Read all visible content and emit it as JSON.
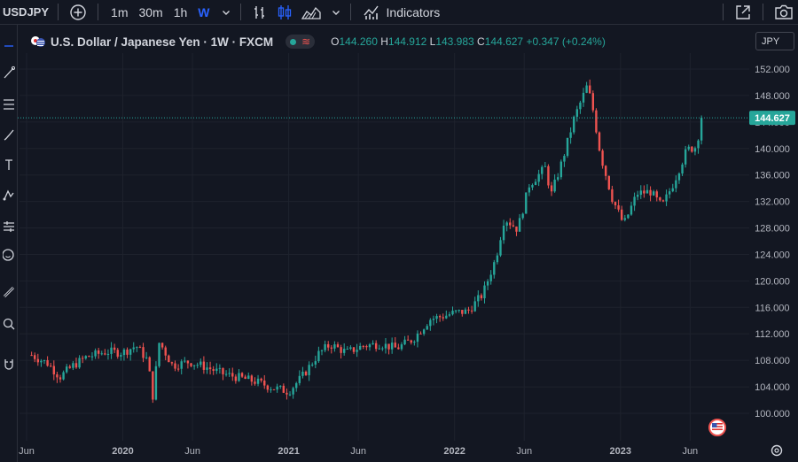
{
  "toolbar": {
    "symbol": "USDJPY",
    "intervals": [
      "1m",
      "30m",
      "1h",
      "W"
    ],
    "indicators_label": "Indicators"
  },
  "legend": {
    "title": "U.S. Dollar / Japanese Yen · 1W · FXCM",
    "open_key": "O",
    "open": "144.260",
    "high_key": "H",
    "high": "144.912",
    "low_key": "L",
    "low": "143.983",
    "close_key": "C",
    "close": "144.627",
    "change": "+0.347 (+0.24%)"
  },
  "currency_label": "JPY",
  "last_price_label": "144.627",
  "colors": {
    "up": "#26a69a",
    "down": "#ef5350",
    "accent": "#2962ff",
    "background": "#131722"
  },
  "chart_data": {
    "type": "candlestick",
    "title": "U.S. Dollar / Japanese Yen · 1W · FXCM",
    "y_ticks": [
      100,
      104,
      108,
      112,
      116,
      120,
      124,
      128,
      132,
      136,
      140,
      144,
      148,
      152
    ],
    "y_tick_labels": [
      "100.000",
      "104.000",
      "108.000",
      "112.000",
      "116.000",
      "120.000",
      "124.000",
      "128.000",
      "132.000",
      "136.000",
      "140.000",
      "144.000",
      "148.000",
      "152.000"
    ],
    "ylim": [
      97.5,
      153.5
    ],
    "x_labels": [
      "Jun",
      "2020",
      "Jun",
      "2021",
      "Jun",
      "2022",
      "Jun",
      "2023",
      "Jun"
    ],
    "last_price": 144.627,
    "series_path": [
      [
        2019.45,
        108.8
      ],
      [
        2019.55,
        107.5
      ],
      [
        2019.62,
        105.5
      ],
      [
        2019.7,
        107.2
      ],
      [
        2019.78,
        108.5
      ],
      [
        2019.9,
        109.3
      ],
      [
        2020.0,
        109.2
      ],
      [
        2020.08,
        110.2
      ],
      [
        2020.15,
        108.0
      ],
      [
        2020.18,
        102.5
      ],
      [
        2020.22,
        110.8
      ],
      [
        2020.3,
        107.2
      ],
      [
        2020.4,
        107.8
      ],
      [
        2020.5,
        107.0
      ],
      [
        2020.6,
        106.0
      ],
      [
        2020.7,
        105.4
      ],
      [
        2020.8,
        104.8
      ],
      [
        2020.9,
        103.9
      ],
      [
        2021.0,
        103.3
      ],
      [
        2021.08,
        105.5
      ],
      [
        2021.18,
        109.0
      ],
      [
        2021.25,
        110.4
      ],
      [
        2021.35,
        109.2
      ],
      [
        2021.45,
        110.2
      ],
      [
        2021.55,
        110.5
      ],
      [
        2021.65,
        109.8
      ],
      [
        2021.75,
        111.2
      ],
      [
        2021.85,
        114.2
      ],
      [
        2021.95,
        114.8
      ],
      [
        2022.0,
        115.2
      ],
      [
        2022.08,
        115.4
      ],
      [
        2022.17,
        118.0
      ],
      [
        2022.25,
        123.5
      ],
      [
        2022.3,
        129.5
      ],
      [
        2022.38,
        127.8
      ],
      [
        2022.45,
        134.5
      ],
      [
        2022.55,
        137.2
      ],
      [
        2022.58,
        132.8
      ],
      [
        2022.65,
        138.2
      ],
      [
        2022.72,
        144.5
      ],
      [
        2022.8,
        149.5
      ],
      [
        2022.83,
        146.5
      ],
      [
        2022.88,
        139.0
      ],
      [
        2022.95,
        132.5
      ],
      [
        2023.02,
        128.5
      ],
      [
        2023.1,
        133.2
      ],
      [
        2023.18,
        133.5
      ],
      [
        2023.25,
        131.2
      ],
      [
        2023.32,
        134.8
      ],
      [
        2023.4,
        139.8
      ],
      [
        2023.45,
        140.2
      ],
      [
        2023.5,
        144.627
      ]
    ]
  }
}
